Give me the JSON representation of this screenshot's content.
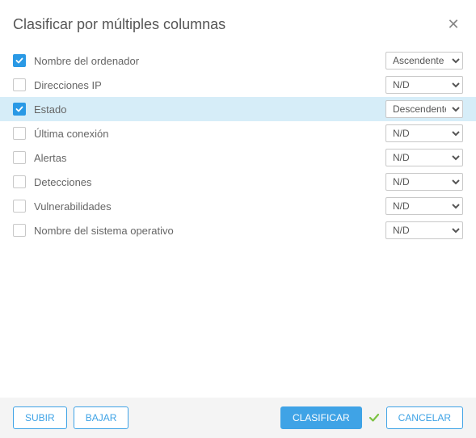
{
  "dialog": {
    "title": "Clasificar por múltiples columnas"
  },
  "rows": [
    {
      "label": "Nombre del ordenador",
      "checked": true,
      "sort": "Ascendente",
      "highlighted": false
    },
    {
      "label": "Direcciones IP",
      "checked": false,
      "sort": "N/D",
      "highlighted": false
    },
    {
      "label": "Estado",
      "checked": true,
      "sort": "Descendente",
      "highlighted": true
    },
    {
      "label": "Última conexión",
      "checked": false,
      "sort": "N/D",
      "highlighted": false
    },
    {
      "label": "Alertas",
      "checked": false,
      "sort": "N/D",
      "highlighted": false
    },
    {
      "label": "Detecciones",
      "checked": false,
      "sort": "N/D",
      "highlighted": false
    },
    {
      "label": "Vulnerabilidades",
      "checked": false,
      "sort": "N/D",
      "highlighted": false
    },
    {
      "label": "Nombre del sistema operativo",
      "checked": false,
      "sort": "N/D",
      "highlighted": false
    }
  ],
  "sortOptions": [
    "N/D",
    "Ascendente",
    "Descendente"
  ],
  "footer": {
    "up": "SUBIR",
    "down": "BAJAR",
    "classify": "CLASIFICAR",
    "cancel": "CANCELAR"
  }
}
